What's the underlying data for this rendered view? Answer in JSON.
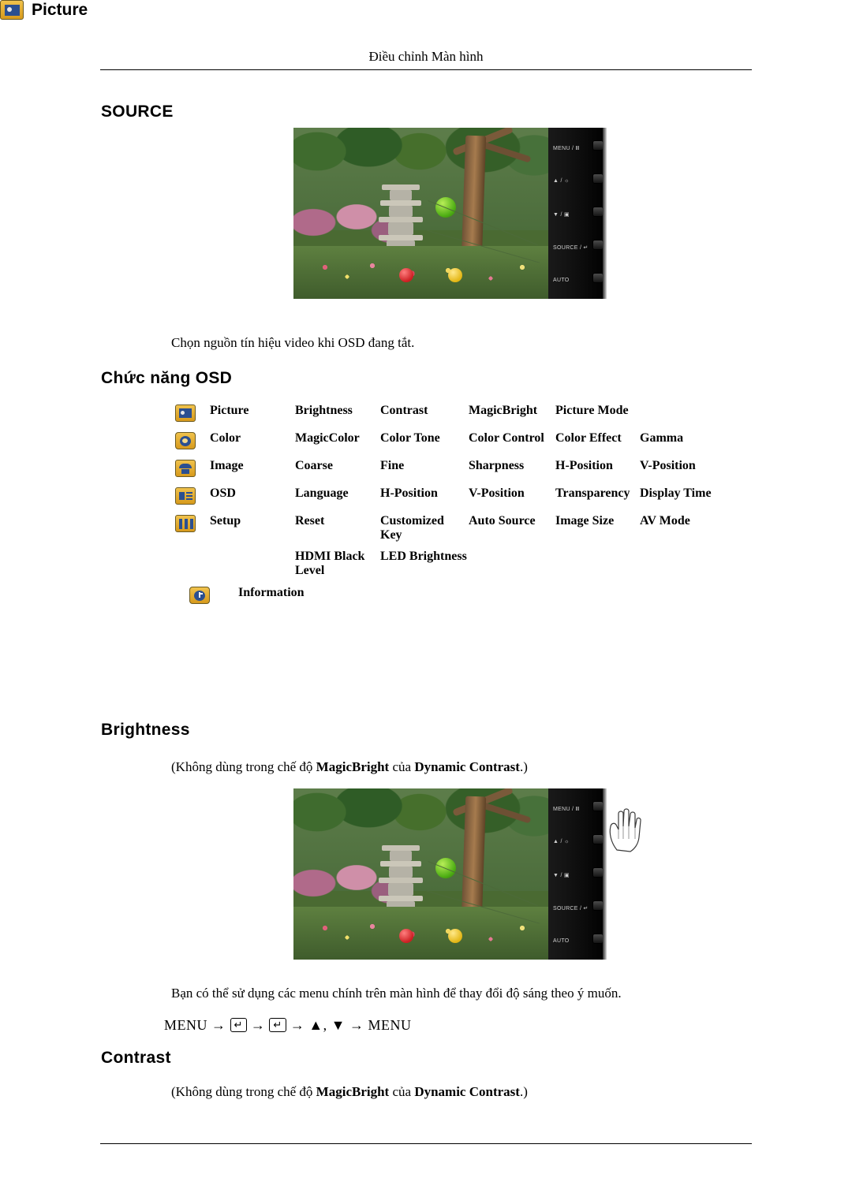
{
  "header": {
    "running_title": "Điều chỉnh Màn hình"
  },
  "sections": {
    "source": {
      "title": "SOURCE",
      "description": "Chọn nguồn tín hiệu video khi OSD đang tắt."
    },
    "osd_functions": {
      "title": "Chức năng OSD"
    },
    "picture": {
      "title": "Picture"
    },
    "brightness": {
      "title": "Brightness",
      "note_prefix": "(Không dùng trong chế độ ",
      "note_bold1": "MagicBright",
      "note_mid": " của ",
      "note_bold2": "Dynamic Contrast",
      "note_suffix": ".)",
      "description": "Bạn có thể sử dụng các menu chính trên màn hình để thay đổi độ sáng theo ý muốn.",
      "menu_path": {
        "start": "MENU",
        "arrow": "→",
        "key1": "↵",
        "key2": "↵",
        "up": "▲",
        "comma": ",",
        "down": "▼",
        "end": "MENU"
      }
    },
    "contrast": {
      "title": "Contrast",
      "note_prefix": "(Không dùng trong chế độ ",
      "note_bold1": "MagicBright",
      "note_mid": " của ",
      "note_bold2": "Dynamic Contrast",
      "note_suffix": ".)"
    }
  },
  "osd_table": {
    "rows": [
      {
        "icon": "picture-icon",
        "label": "Picture",
        "items": [
          "Brightness",
          "Contrast",
          "MagicBright",
          "Picture Mode"
        ]
      },
      {
        "icon": "color-icon",
        "label": "Color",
        "items": [
          "MagicColor",
          "Color Tone",
          "Color Control",
          "Color Effect",
          "Gamma"
        ]
      },
      {
        "icon": "image-icon",
        "label": "Image",
        "items": [
          "Coarse",
          "Fine",
          "Sharpness",
          "H-Position",
          "V-Position"
        ]
      },
      {
        "icon": "osd-icon",
        "label": "OSD",
        "items": [
          "Language",
          "H-Position",
          "V-Position",
          "Transparency",
          "Display Time"
        ]
      },
      {
        "icon": "setup-icon",
        "label": "Setup",
        "items": [
          "Reset",
          "Customized Key",
          "Auto Source",
          "Image Size",
          "AV Mode"
        ],
        "subitems": [
          "HDMI Black Level",
          "LED Brightness"
        ]
      },
      {
        "icon": "information-icon",
        "label": "Information",
        "items": []
      }
    ]
  },
  "monitor_panel": {
    "buttons": [
      {
        "label": "MENU / Ⅲ"
      },
      {
        "label": "▲ / ☼"
      },
      {
        "label": "▼ / ▣"
      },
      {
        "label": "SOURCE / ↵"
      },
      {
        "label": "AUTO"
      }
    ]
  },
  "colors": {
    "icon_gold": "#e0ae33",
    "icon_blue": "#1d3f7a",
    "text": "#000000",
    "lantern_green": "#4fae14"
  }
}
